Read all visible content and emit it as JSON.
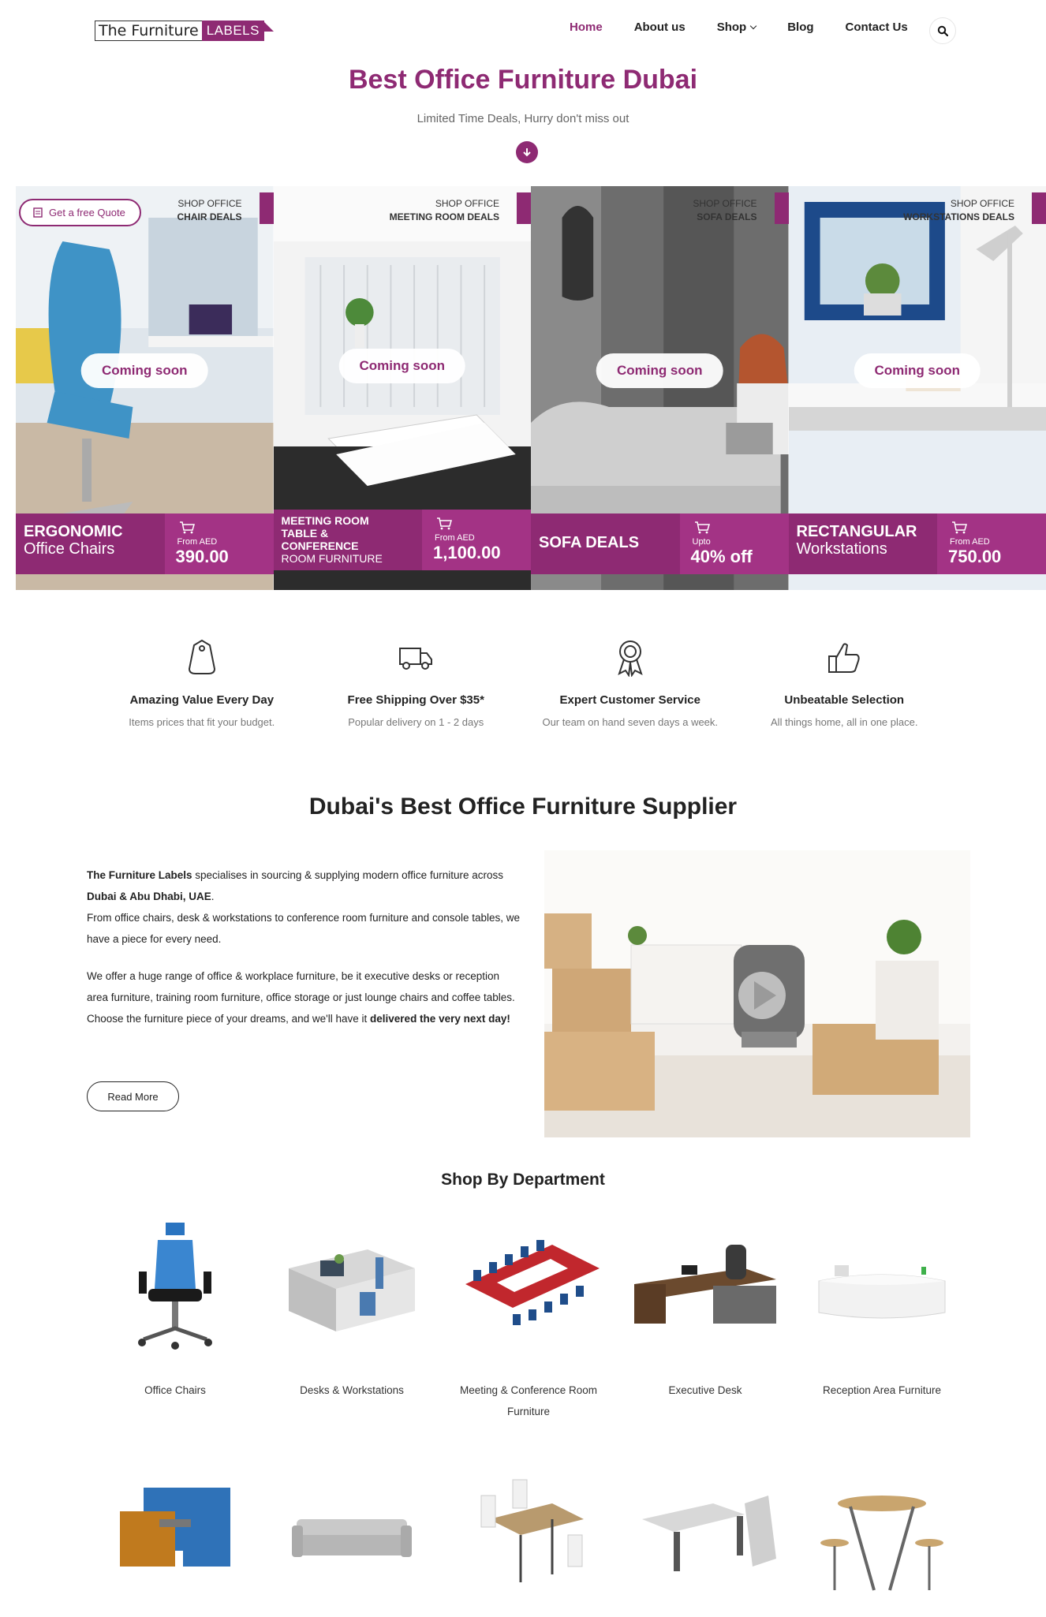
{
  "header": {
    "logo_text": "The Furniture",
    "logo_box": "LABELS",
    "nav": [
      "Home",
      "About us",
      "Shop",
      "Blog",
      "Contact Us"
    ]
  },
  "hero": {
    "title": "Best Office Furniture Dubai",
    "subtitle": "Limited Time Deals, Hurry don't miss out"
  },
  "quote_button": "Get a free Quote",
  "deals": [
    {
      "shop": "SHOP OFFICE",
      "category": "CHAIR DEALS",
      "badge": "Coming soon",
      "name_big": "ERGONOMIC",
      "name_small": "Office Chairs",
      "from": "From AED",
      "price": "390.00"
    },
    {
      "shop": "SHOP OFFICE",
      "category": "MEETING ROOM DEALS",
      "badge": "Coming soon",
      "name_big": "MEETING ROOM TABLE & CONFERENCE",
      "name_small": "ROOM FURNITURE",
      "from": "From AED",
      "price": "1,100.00"
    },
    {
      "shop": "SHOP OFFICE",
      "category": "SOFA DEALS",
      "badge": "Coming soon",
      "name_big": "SOFA DEALS",
      "name_small": "",
      "from": "Upto",
      "price": "40% off"
    },
    {
      "shop": "SHOP OFFICE",
      "category": "WORKSTATIONS DEALS",
      "badge": "Coming soon",
      "name_big": "RECTANGULAR",
      "name_small": "Workstations",
      "from": "From AED",
      "price": "750.00"
    }
  ],
  "features": [
    {
      "icon": "price-tag-icon",
      "title": "Amazing Value Every Day",
      "desc": "Items prices that fit your budget."
    },
    {
      "icon": "truck-icon",
      "title": "Free Shipping Over $35*",
      "desc": "Popular delivery on 1 - 2 days"
    },
    {
      "icon": "award-icon",
      "title": "Expert Customer Service",
      "desc": "Our team on hand seven days a week."
    },
    {
      "icon": "thumbs-up-icon",
      "title": "Unbeatable Selection",
      "desc": "All things home, all in one place."
    }
  ],
  "supplier": {
    "title": "Dubai's Best Office Furniture Supplier",
    "p1_brand": "The Furniture Labels",
    "p1_a": " specialises in sourcing & supplying modern office furniture across ",
    "p1_loc": "Dubai & Abu Dhabi, UAE",
    "p1_b": ".",
    "p1_c": "From office chairs, desk & workstations to conference room furniture and console tables, we have a piece for every need.",
    "p2_a": "We offer a huge range of office & workplace furniture, be it executive desks or reception area furniture, training room furniture, office storage or just lounge chairs and coffee tables. Choose the furniture piece of your dreams, and we'll have it ",
    "p2_b": "delivered the very next day!",
    "read_more": "Read More"
  },
  "departments": {
    "title": "Shop By Department",
    "items": [
      "Office Chairs",
      "Desks & Workstations",
      "Meeting & Conference Room Furniture",
      "Executive Desk",
      "Reception Area Furniture"
    ]
  },
  "colors": {
    "brand": "#8e2a73",
    "brand_light": "#a33385"
  }
}
